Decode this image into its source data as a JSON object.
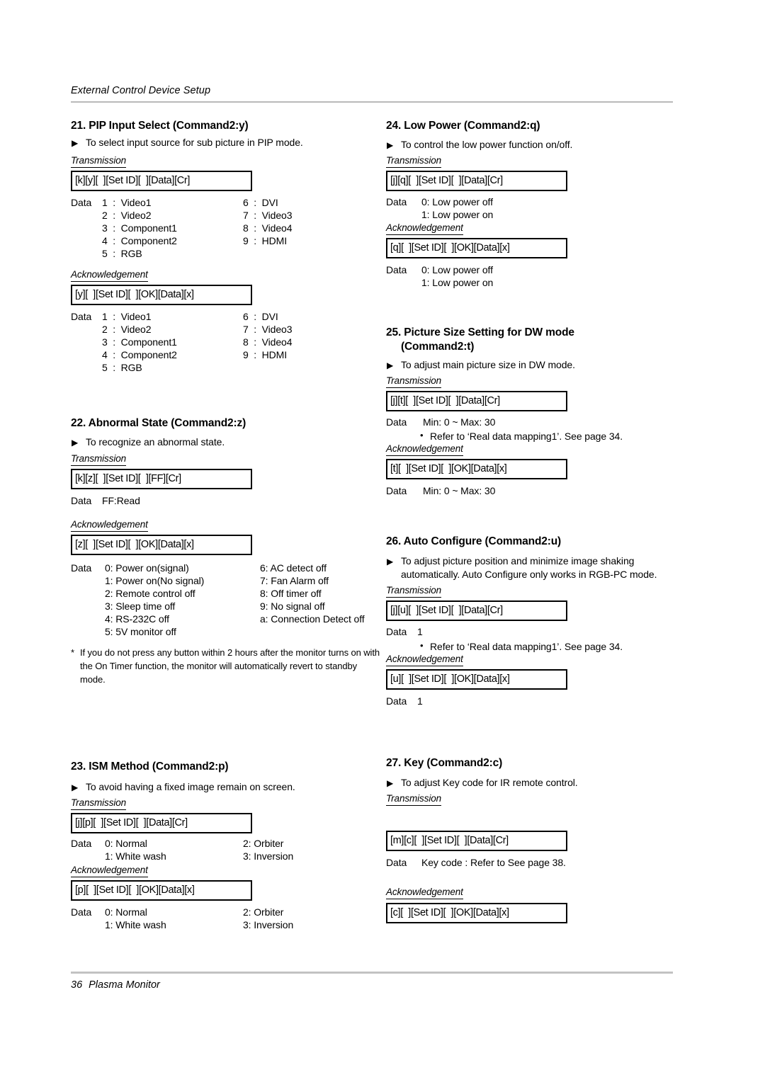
{
  "header": {
    "title": "External Control Device Setup"
  },
  "footer": {
    "page_number": "36",
    "product": "Plasma Monitor"
  },
  "labels": {
    "transmission": "Transmission",
    "acknowledgement": "Acknowledgement",
    "data": "Data",
    "triangle": "▶",
    "bullet": "•",
    "asterisk": "*"
  },
  "sections": {
    "s21": {
      "title": "21. PIP Input Select (Command2:y)",
      "desc": "To select input source for sub picture in PIP mode.",
      "tx_cmd": "[k][y][  ][Set ID][  ][Data][Cr]",
      "tx_rows_c1": [
        "1  :  Video1",
        "2  :  Video2",
        "3  :  Component1",
        "4  :  Component2",
        "5  :  RGB"
      ],
      "tx_rows_c2": [
        "6  :  DVI",
        "7  :  Video3",
        "8  :  Video4",
        "9  :  HDMI",
        ""
      ],
      "ack_cmd": "[y][  ][Set ID][  ][OK][Data][x]",
      "ack_rows_c1": [
        "1  :  Video1",
        "2  :  Video2",
        "3  :  Component1",
        "4  :  Component2",
        "5  :  RGB"
      ],
      "ack_rows_c2": [
        "6  :  DVI",
        "7  :  Video3",
        "8  :  Video4",
        "9  :  HDMI",
        ""
      ]
    },
    "s22": {
      "title": "22. Abnormal State (Command2:z)",
      "desc": "To recognize an abnormal state.",
      "tx_cmd": "[k][z][  ][Set ID][  ][FF][Cr]",
      "tx_data": "FF:Read",
      "ack_cmd": "[z][  ][Set ID][  ][OK][Data][x]",
      "ack_rows_c1": [
        "0: Power on(signal)",
        "1: Power on(No signal)",
        "2: Remote control off",
        "3: Sleep time off",
        "4: RS-232C off",
        "5: 5V monitor off"
      ],
      "ack_rows_c2": [
        "6: AC detect off",
        "7: Fan Alarm off",
        "8: Off timer off",
        "9: No signal off",
        "a: Connection Detect off",
        ""
      ],
      "footnote": "If you do not press any button within 2 hours after the monitor turns on with the On Timer function, the monitor will automatically revert to standby mode."
    },
    "s23": {
      "title": "23. ISM Method (Command2:p)",
      "desc": "To avoid having a fixed image remain on screen.",
      "tx_cmd": "[j][p][  ][Set ID][  ][Data][Cr]",
      "tx_rows_c1": [
        "0: Normal",
        "1: White wash"
      ],
      "tx_rows_c2": [
        "2: Orbiter",
        "3: Inversion"
      ],
      "ack_cmd": "[p][  ][Set ID][  ][OK][Data][x]",
      "ack_rows_c1": [
        "0: Normal",
        "1: White wash"
      ],
      "ack_rows_c2": [
        "2: Orbiter",
        "3: Inversion"
      ]
    },
    "s24": {
      "title": "24. Low Power (Command2:q)",
      "desc": "To control the low power function on/off.",
      "tx_cmd": "[j][q][  ][Set ID][  ][Data][Cr]",
      "tx_rows_c1": [
        "0: Low power off",
        "1: Low power on"
      ],
      "ack_cmd": "[q][  ][Set ID][  ][OK][Data][x]",
      "ack_rows_c1": [
        "0: Low power off",
        "1: Low power on"
      ]
    },
    "s25": {
      "title_line1": "25. Picture Size Setting for DW mode",
      "title_line2": "(Command2:t)",
      "desc": "To adjust main picture size in DW mode.",
      "tx_cmd": "[j][t][  ][Set ID][  ][Data][Cr]",
      "tx_data": "Min: 0 ~ Max: 30",
      "tx_note": "Refer to ‘Real data mapping1’. See page 34.",
      "ack_cmd": "[t][  ][Set ID][  ][OK][Data][x]",
      "ack_data": "Min: 0 ~ Max: 30"
    },
    "s26": {
      "title": "26. Auto Configure (Command2:u)",
      "desc": "To adjust picture position and minimize image shaking automatically. Auto Configure only works in RGB-PC mode.",
      "tx_cmd": "[j][u][  ][Set ID][  ][Data][Cr]",
      "tx_data": "1",
      "tx_note": "Refer to ‘Real data mapping1’. See page 34.",
      "ack_cmd": "[u][  ][Set ID][  ][OK][Data][x]",
      "ack_data": "1"
    },
    "s27": {
      "title": "27. Key (Command2:c)",
      "desc": "To adjust Key code for IR remote control.",
      "tx_cmd": "[m][c][  ][Set ID][  ][Data][Cr]",
      "tx_data": "Key code : Refer to See page 38.",
      "ack_cmd": "[c][  ][Set ID][  ][OK][Data][x]"
    }
  }
}
